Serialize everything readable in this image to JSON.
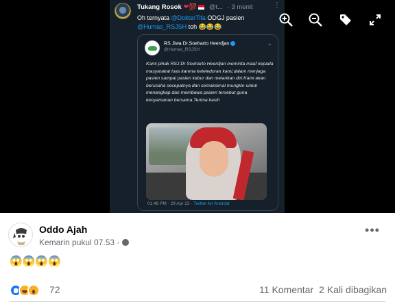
{
  "viewer": {
    "tweet": {
      "author": "Tukang Rosok",
      "hundred": "💯",
      "handle": "@t...",
      "time": "· 3 menit",
      "text_prefix": "Oh ternyata ",
      "mention_1": "@DokterTifa",
      "text_middle": " ODGJ pasien ",
      "mention_2": "@Humas_RSJSH",
      "text_suffix": " toh 😂😂😂",
      "more": "⋮",
      "quoted": {
        "account_name": "RS Jiwa Dr.Soeharto Heerdjan",
        "account_handle": "@Humas_RSJSH",
        "more": "⌄",
        "body": "Kami pihak RSJ Dr Soeharto Heerdjan meminta maaf kepada masyarakat luas karena keteledoran kami,dalam menjaga pasien sampai pasien kabur dan melarikan diri.Kami akan berusaha secepatnya dan semaksimal mungkin untuk menangkap dan membawa pasien tersebut guna kenyamanan bersama.Terima kasih",
        "timestamp": "01:48 PM · 29 Apr 22 · ",
        "app": "Twitter for Android"
      }
    },
    "controls": [
      {
        "icon": "zoom-in-icon"
      },
      {
        "icon": "zoom-out-icon"
      },
      {
        "icon": "tag-icon"
      },
      {
        "icon": "fullscreen-icon"
      }
    ]
  },
  "post": {
    "author": "Oddo Ajah",
    "timestamp": "Kemarin pukul 07.53 ·",
    "text": "😱😱😱😱",
    "more": "•••",
    "reaction_count": "72",
    "comments": "11 Komentar",
    "shares": "2 Kali dibagikan"
  },
  "colors": {
    "viewer_bg": "#000000",
    "tweet_bg": "#15202b",
    "link_blue": "#1d9bf0",
    "muted_text": "#65676b"
  }
}
